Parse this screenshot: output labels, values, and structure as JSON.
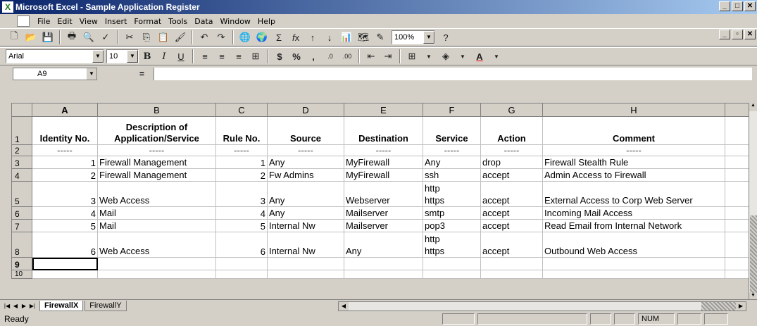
{
  "window": {
    "title": "Microsoft Excel - Sample Application Register"
  },
  "menu": [
    "File",
    "Edit",
    "View",
    "Insert",
    "Format",
    "Tools",
    "Data",
    "Window",
    "Help"
  ],
  "toolbar": {
    "zoom": "100%"
  },
  "format_toolbar": {
    "font": "Arial",
    "size": "10"
  },
  "formula_bar": {
    "cell_ref": "A9",
    "fx": "="
  },
  "columns": [
    "A",
    "B",
    "C",
    "D",
    "E",
    "F",
    "G",
    "H"
  ],
  "header_row": [
    "Identity No.",
    "Description of\nApplication/Service",
    "Rule No.",
    "Source",
    "Destination",
    "Service",
    "Action",
    "Comment"
  ],
  "dash": "-----",
  "rows": [
    {
      "n": "3",
      "cells": [
        "1",
        "Firewall Management",
        "1",
        "Any",
        "MyFirewall",
        "Any",
        "drop",
        "Firewall Stealth Rule"
      ]
    },
    {
      "n": "4",
      "cells": [
        "2",
        "Firewall Management",
        "2",
        "Fw Admins",
        "MyFirewall",
        "ssh",
        "accept",
        "Admin Access to Firewall"
      ]
    },
    {
      "n": "5",
      "cells": [
        "3",
        "Web Access",
        "3",
        "Any",
        "Webserver",
        "http\nhttps",
        "accept",
        "External Access to Corp Web Server"
      ]
    },
    {
      "n": "6",
      "cells": [
        "4",
        "Mail",
        "4",
        "Any",
        "Mailserver",
        "smtp",
        "accept",
        "Incoming Mail Access"
      ]
    },
    {
      "n": "7",
      "cells": [
        "5",
        "Mail",
        "5",
        "Internal Nw",
        "Mailserver",
        "pop3",
        "accept",
        "Read Email from Internal Network"
      ]
    },
    {
      "n": "8",
      "cells": [
        "6",
        "Web Access",
        "6",
        "Internal Nw",
        "Any",
        "http\nhttps",
        "accept",
        "Outbound Web Access"
      ]
    }
  ],
  "row_numbers": [
    "1",
    "2",
    "9",
    "10"
  ],
  "tabs": [
    "FirewallX",
    "FirewallY"
  ],
  "status": {
    "left": "Ready",
    "num": "NUM"
  }
}
